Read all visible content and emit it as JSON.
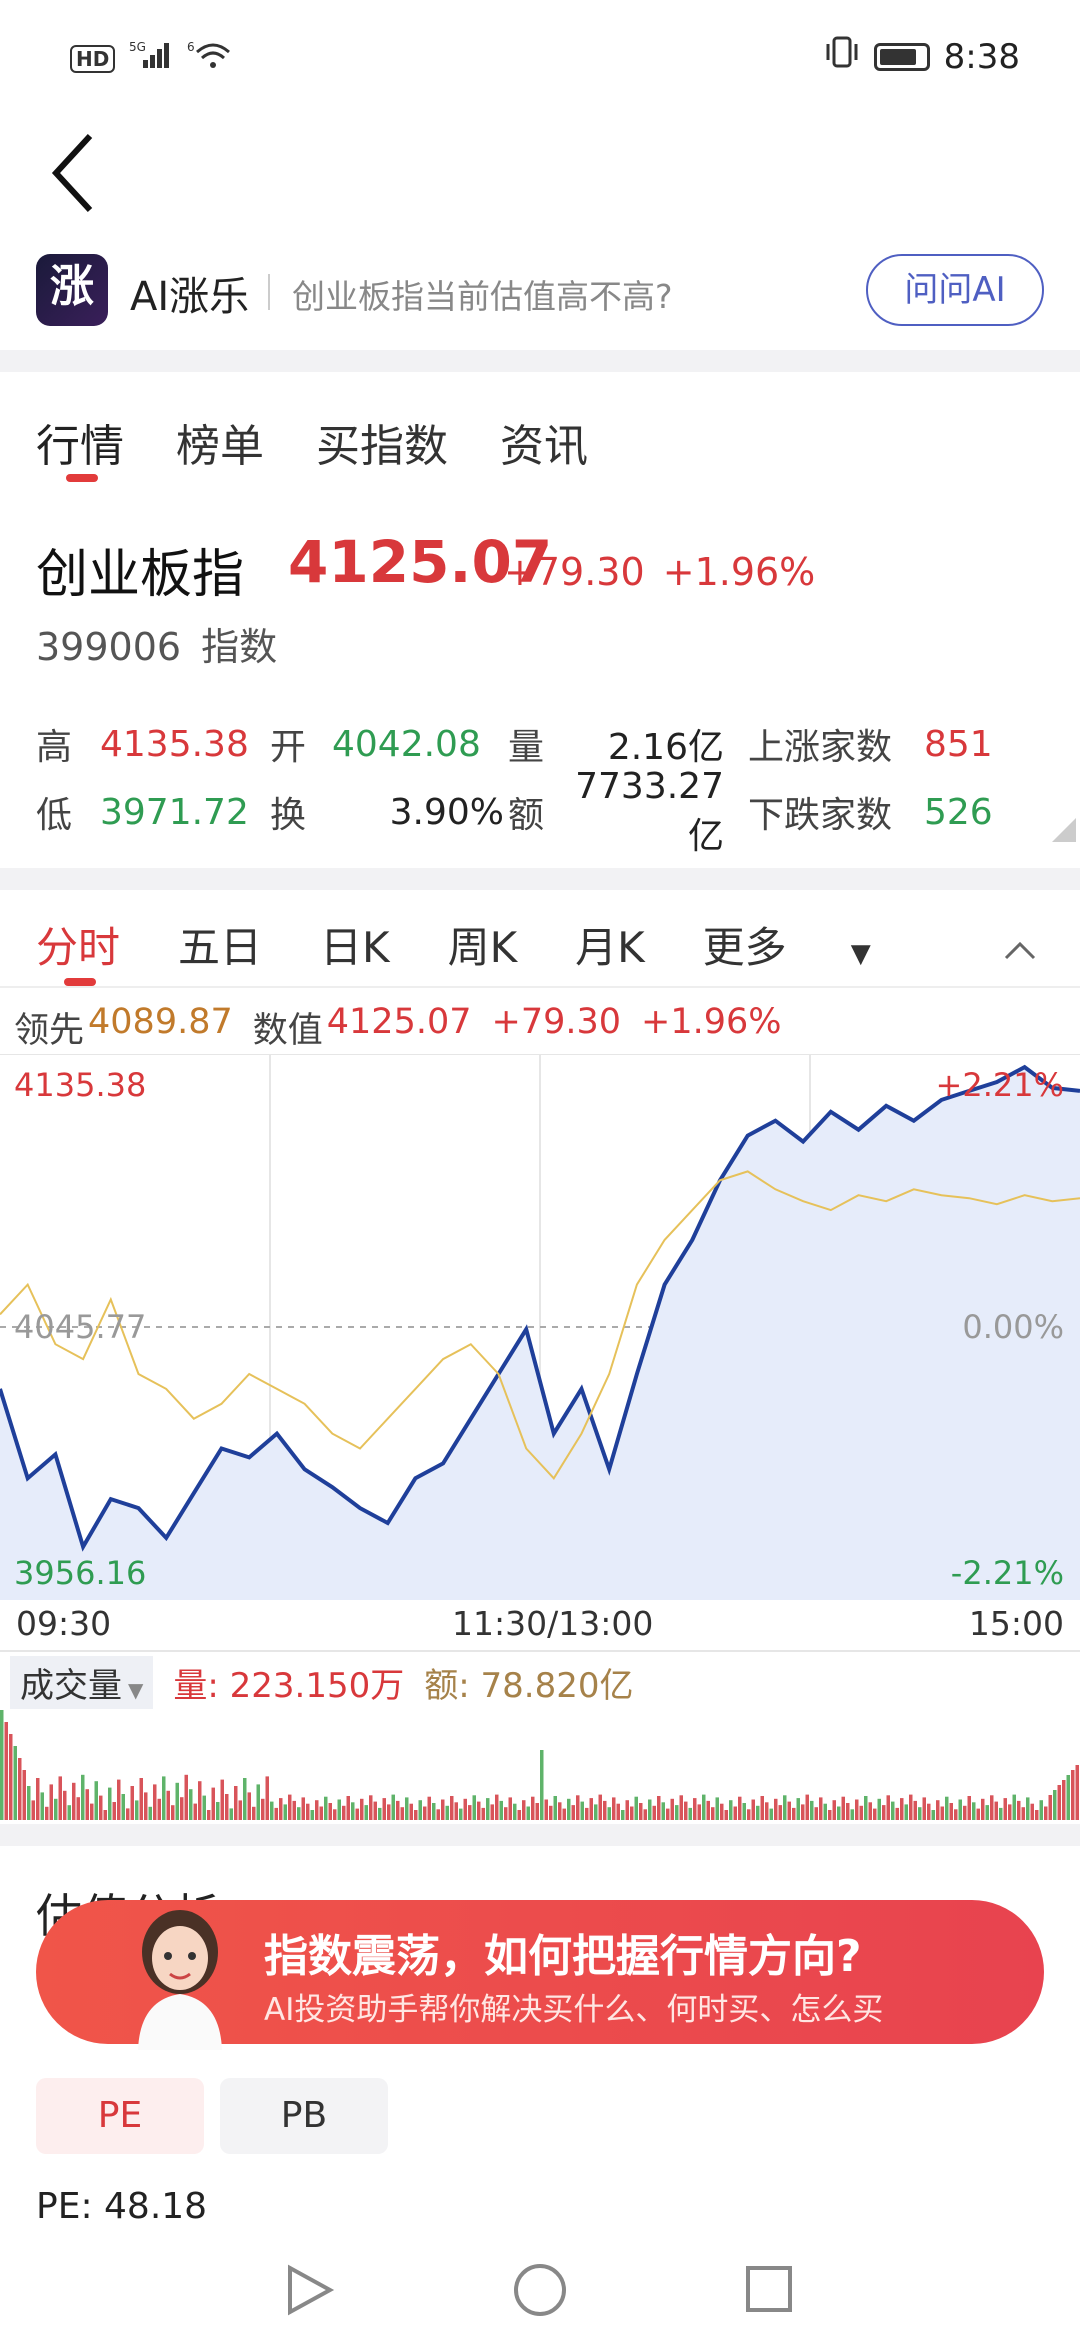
{
  "status_bar": {
    "left_text": "HD",
    "signal_text": "5G",
    "wifi_text": "6",
    "time": "8:38"
  },
  "ai_bar": {
    "logo_text": "涨",
    "title": "AI涨乐",
    "question": "创业板指当前估值高不高?",
    "ask_button": "问问AI"
  },
  "tabs": [
    "行情",
    "榜单",
    "买指数",
    "资讯"
  ],
  "index": {
    "name": "创业板指",
    "price": "4125.07",
    "change": "+79.30",
    "change_pct": "+1.96%",
    "code": "399006",
    "type": "指数"
  },
  "stats": {
    "high_label": "高",
    "high": "4135.38",
    "open_label": "开",
    "open": "4042.08",
    "vol_label": "量",
    "vol": "2.16亿",
    "up_label": "上涨家数",
    "up": "851",
    "low_label": "低",
    "low": "3971.72",
    "turn_label": "换",
    "turn": "3.90%",
    "amt_label": "额",
    "amt": "7733.27亿",
    "down_label": "下跌家数",
    "down": "526"
  },
  "chart_tabs": [
    "分时",
    "五日",
    "日K",
    "周K",
    "月K",
    "更多"
  ],
  "legend": {
    "lead_label": "领先",
    "lead_value": "4089.87",
    "value_label": "数值",
    "value": "4125.07",
    "change": "+79.30",
    "change_pct": "+1.96%"
  },
  "chart_labels": {
    "y_high": "4135.38",
    "y_mid": "4045.77",
    "y_low": "3956.16",
    "pct_high": "+2.21%",
    "pct_mid": "0.00%",
    "pct_low": "-2.21%",
    "t_start": "09:30",
    "t_mid": "11:30/13:00",
    "t_end": "15:00"
  },
  "volume": {
    "dropdown": "成交量",
    "qty": "量: 223.150万",
    "amt": "额: 78.820亿"
  },
  "valuation": {
    "title_partial": "估值分析",
    "banner_title": "指数震荡，如何把握行情方向?",
    "banner_sub": "AI投资助手帮你解决买什么、何时买、怎么买",
    "pe_tab": "PE",
    "pb_tab": "PB",
    "pe_value": "PE: 48.18"
  },
  "colors": {
    "up": "#d8383b",
    "down": "#2f9c52",
    "price_line": "#1f3f9a",
    "lead_line": "#e6c15a",
    "accent": "#4f5fc2"
  },
  "chart_data": {
    "type": "line",
    "title": "",
    "xlabel": "",
    "ylabel": "",
    "ylim": [
      3956.16,
      4135.38
    ],
    "x": [
      "09:30",
      "11:30/13:00",
      "15:00"
    ],
    "series": [
      {
        "name": "数值",
        "color": "#1f3f9a",
        "values": [
          4025,
          3995,
          4003,
          3972,
          3988,
          3985,
          3975,
          3990,
          4005,
          4002,
          4010,
          3998,
          3992,
          3985,
          3980,
          3995,
          4000,
          4015,
          4030,
          4045,
          4010,
          4025,
          3998,
          4030,
          4060,
          4075,
          4095,
          4110,
          4115,
          4108,
          4118,
          4112,
          4120,
          4115,
          4122,
          4125,
          4128,
          4133,
          4126,
          4125
        ]
      },
      {
        "name": "领先",
        "color": "#e6c15a",
        "values": [
          4050,
          4060,
          4040,
          4035,
          4055,
          4030,
          4025,
          4015,
          4020,
          4030,
          4025,
          4020,
          4010,
          4005,
          4015,
          4025,
          4035,
          4040,
          4030,
          4005,
          3995,
          4010,
          4030,
          4060,
          4075,
          4085,
          4095,
          4098,
          4092,
          4088,
          4085,
          4090,
          4088,
          4092,
          4090,
          4089,
          4087,
          4090,
          4088,
          4089
        ]
      }
    ]
  }
}
